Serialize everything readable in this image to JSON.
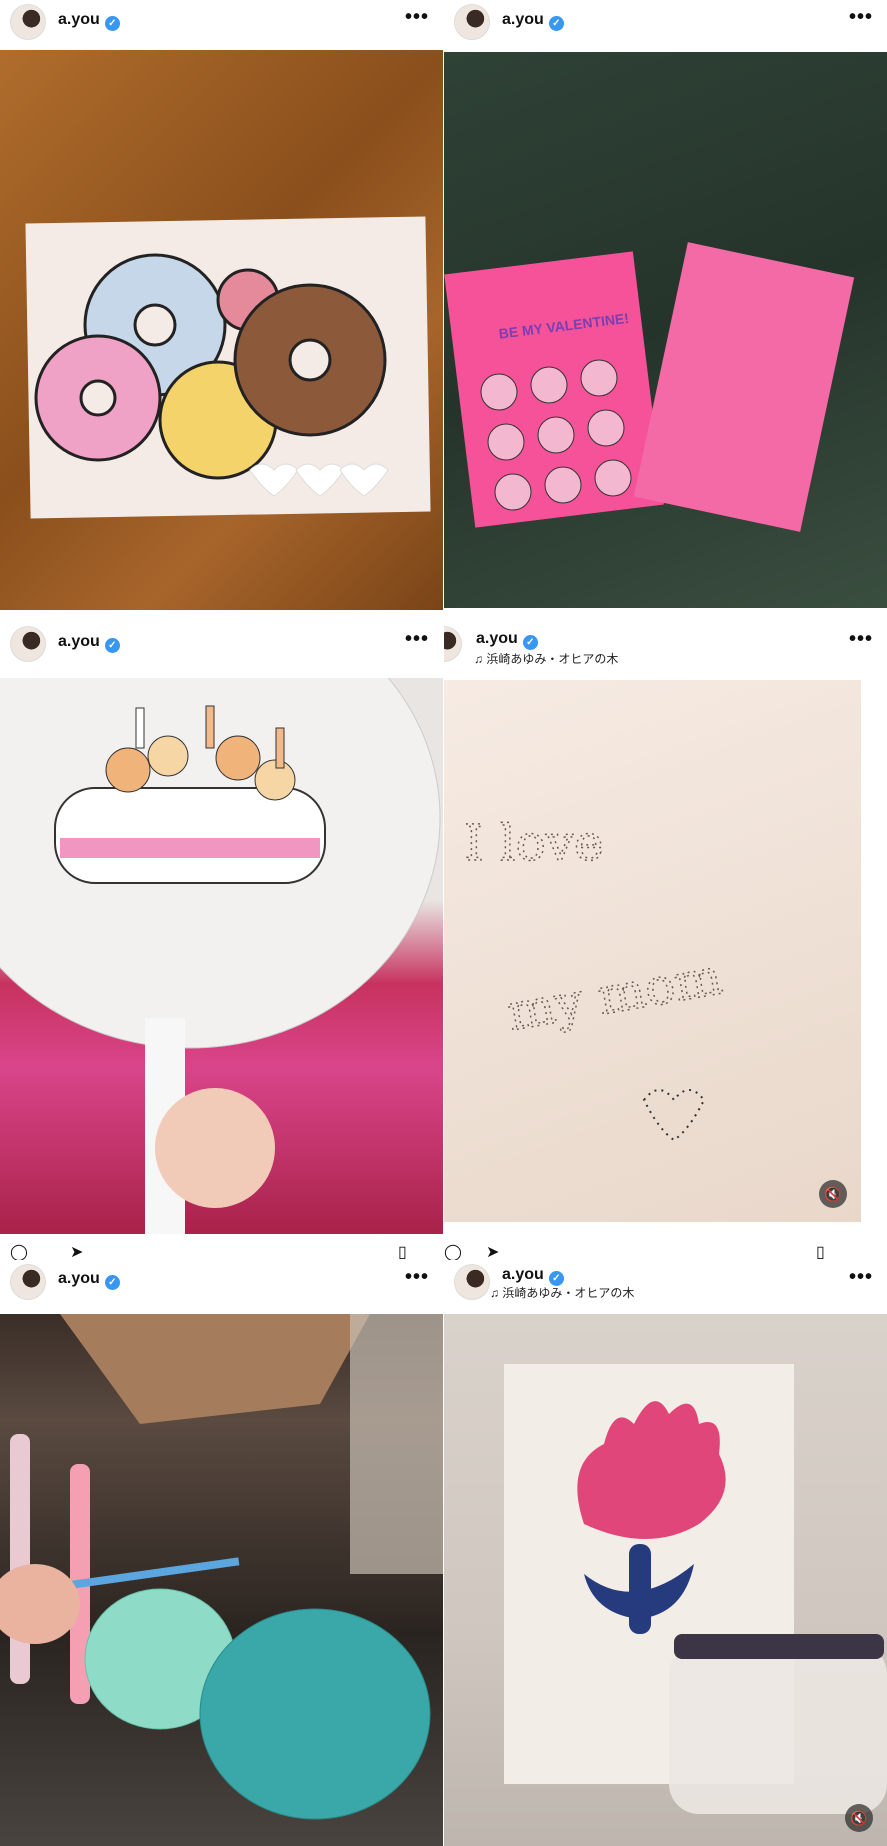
{
  "posts": [
    {
      "username": "a.you",
      "verified": true,
      "more": "•••",
      "music": ""
    },
    {
      "username": "a.you",
      "verified": true,
      "more": "•••",
      "music": ""
    },
    {
      "username": "a.you",
      "verified": true,
      "more": "•••",
      "music": ""
    },
    {
      "username": "a.you",
      "verified": true,
      "more": "•••",
      "music": "♫ 浜崎あゆみ・オヒアの木",
      "handwriting": [
        "I love",
        "my mom"
      ]
    },
    {
      "username": "a.you",
      "verified": true,
      "more": "•••",
      "music": ""
    },
    {
      "username": "a.you",
      "verified": true,
      "more": "•••",
      "music": "♫ 浜崎あゆみ・オヒアの木"
    }
  ],
  "card_text": {
    "be_my_valentine": "BE MY VALENTINE!"
  },
  "icons": {
    "verified": "verified-badge-icon",
    "mute": "muted-speaker-icon",
    "share": "paper-plane-icon",
    "comment": "comment-icon",
    "save": "bookmark-icon"
  },
  "colors": {
    "verified": "#3897f0",
    "pink_card": "#f5529a",
    "marble": "#2e3f34"
  }
}
